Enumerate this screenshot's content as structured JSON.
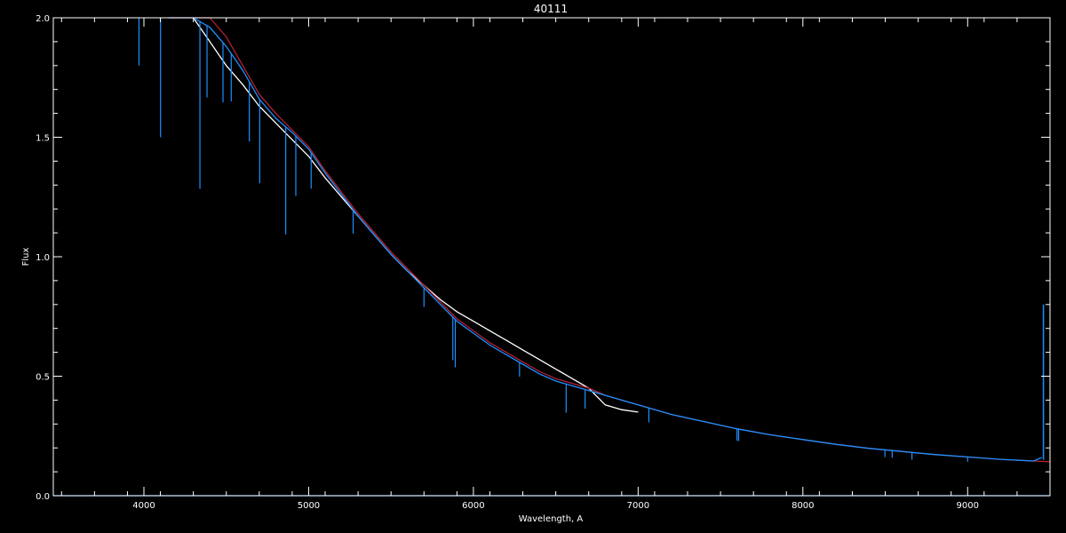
{
  "chart_data": {
    "type": "line",
    "title": "40111",
    "xlabel": "Wavelength, A",
    "ylabel": "Flux",
    "xlim": [
      3450,
      9500
    ],
    "ylim": [
      0.0,
      2.0
    ],
    "x_ticks": [
      4000,
      5000,
      6000,
      7000,
      8000,
      9000
    ],
    "y_ticks": [
      0.0,
      0.5,
      1.0,
      1.5,
      2.0
    ],
    "x_tick_labels": [
      "4000",
      "5000",
      "6000",
      "7000",
      "8000",
      "9000"
    ],
    "y_tick_labels": [
      "0.0",
      "0.5",
      "1.0",
      "1.5",
      "2.0"
    ],
    "grid": false,
    "background": "#000000",
    "series": [
      {
        "color": "#ffffff",
        "x": [
          4300,
          4400,
          4500,
          4600,
          4700,
          4800,
          4900,
          5000,
          5100,
          5200,
          5300,
          5400,
          5500,
          5600,
          5700,
          5800,
          5900,
          6000,
          6100,
          6200,
          6300,
          6400,
          6500,
          6600,
          6700,
          6800,
          6900,
          7000
        ],
        "y": [
          2.0,
          1.9,
          1.8,
          1.72,
          1.63,
          1.56,
          1.49,
          1.42,
          1.33,
          1.25,
          1.17,
          1.09,
          1.01,
          0.94,
          0.88,
          0.82,
          0.77,
          0.73,
          0.69,
          0.65,
          0.61,
          0.57,
          0.53,
          0.49,
          0.45,
          0.38,
          0.36,
          0.35
        ]
      },
      {
        "color": "#b22234",
        "x": [
          4150,
          4300,
          4400,
          4500,
          4600,
          4700,
          4800,
          4900,
          5000,
          5100,
          5200,
          5300,
          5400,
          5500,
          5600,
          5700,
          5800,
          5900,
          6000,
          6100,
          6200,
          6300,
          6400,
          6500,
          6600,
          6700,
          6800,
          6900,
          7000,
          7200,
          7400,
          7600,
          7800,
          8000,
          8200,
          8400,
          8600,
          8800,
          9000,
          9200,
          9400,
          9500
        ],
        "y": [
          2.15,
          2.08,
          2.0,
          1.92,
          1.8,
          1.68,
          1.6,
          1.53,
          1.46,
          1.36,
          1.27,
          1.18,
          1.1,
          1.02,
          0.95,
          0.88,
          0.81,
          0.74,
          0.69,
          0.64,
          0.6,
          0.56,
          0.52,
          0.49,
          0.47,
          0.45,
          0.42,
          0.4,
          0.38,
          0.34,
          0.31,
          0.28,
          0.255,
          0.235,
          0.215,
          0.198,
          0.185,
          0.172,
          0.162,
          0.152,
          0.145,
          0.142
        ]
      },
      {
        "color": "#1e90ff",
        "x": [
          4150,
          4300,
          4400,
          4500,
          4600,
          4700,
          4800,
          4900,
          5000,
          5100,
          5200,
          5300,
          5400,
          5500,
          5600,
          5700,
          5800,
          5900,
          6000,
          6100,
          6200,
          6300,
          6400,
          6500,
          6600,
          6700,
          6800,
          6900,
          7000,
          7200,
          7400,
          7600,
          7800,
          8000,
          8200,
          8400,
          8600,
          8800,
          9000,
          9200,
          9400,
          9450
        ],
        "y": [
          2.05,
          2.0,
          1.96,
          1.88,
          1.78,
          1.66,
          1.58,
          1.52,
          1.45,
          1.35,
          1.26,
          1.17,
          1.09,
          1.01,
          0.94,
          0.87,
          0.8,
          0.73,
          0.68,
          0.63,
          0.59,
          0.55,
          0.51,
          0.48,
          0.46,
          0.44,
          0.42,
          0.4,
          0.38,
          0.34,
          0.31,
          0.28,
          0.255,
          0.235,
          0.215,
          0.198,
          0.185,
          0.172,
          0.162,
          0.152,
          0.145,
          0.16
        ]
      },
      {
        "color": "#1e90ff",
        "x": [
          3450,
          9500
        ],
        "y": [
          0.0,
          0.0
        ]
      }
    ],
    "absorption_lines": [
      {
        "x": 3970,
        "depth": 0.2,
        "color": "#1e90ff"
      },
      {
        "x": 4101,
        "depth": 0.5,
        "color": "#1e90ff"
      },
      {
        "x": 4340,
        "depth": 0.7,
        "color": "#1e90ff"
      },
      {
        "x": 4383,
        "depth": 0.3,
        "color": "#1e90ff"
      },
      {
        "x": 4480,
        "depth": 0.25,
        "color": "#1e90ff"
      },
      {
        "x": 4530,
        "depth": 0.2,
        "color": "#1e90ff"
      },
      {
        "x": 4640,
        "depth": 0.25,
        "color": "#1e90ff"
      },
      {
        "x": 4703,
        "depth": 0.35,
        "color": "#1e90ff"
      },
      {
        "x": 4861,
        "depth": 0.45,
        "color": "#1e90ff"
      },
      {
        "x": 4922,
        "depth": 0.25,
        "color": "#1e90ff"
      },
      {
        "x": 5015,
        "depth": 0.15,
        "color": "#1e90ff"
      },
      {
        "x": 5270,
        "depth": 0.1,
        "color": "#1e90ff"
      },
      {
        "x": 5700,
        "depth": 0.08,
        "color": "#1e90ff"
      },
      {
        "x": 5875,
        "depth": 0.18,
        "color": "#1e90ff"
      },
      {
        "x": 5890,
        "depth": 0.2,
        "color": "#1e90ff"
      },
      {
        "x": 6280,
        "depth": 0.06,
        "color": "#1e90ff"
      },
      {
        "x": 6563,
        "depth": 0.12,
        "color": "#1e90ff"
      },
      {
        "x": 6678,
        "depth": 0.08,
        "color": "#1e90ff"
      },
      {
        "x": 7065,
        "depth": 0.06,
        "color": "#1e90ff"
      },
      {
        "x": 7600,
        "depth": 0.05,
        "color": "#1e90ff"
      },
      {
        "x": 7610,
        "depth": 0.05,
        "color": "#1e90ff"
      },
      {
        "x": 8498,
        "depth": 0.03,
        "color": "#1e90ff"
      },
      {
        "x": 8542,
        "depth": 0.03,
        "color": "#1e90ff"
      },
      {
        "x": 8662,
        "depth": 0.03,
        "color": "#1e90ff"
      },
      {
        "x": 9000,
        "depth": 0.02,
        "color": "#1e90ff"
      }
    ],
    "edge_spike": {
      "x": 9460,
      "from": 0.15,
      "to": 0.8,
      "color": "#1e90ff"
    }
  }
}
